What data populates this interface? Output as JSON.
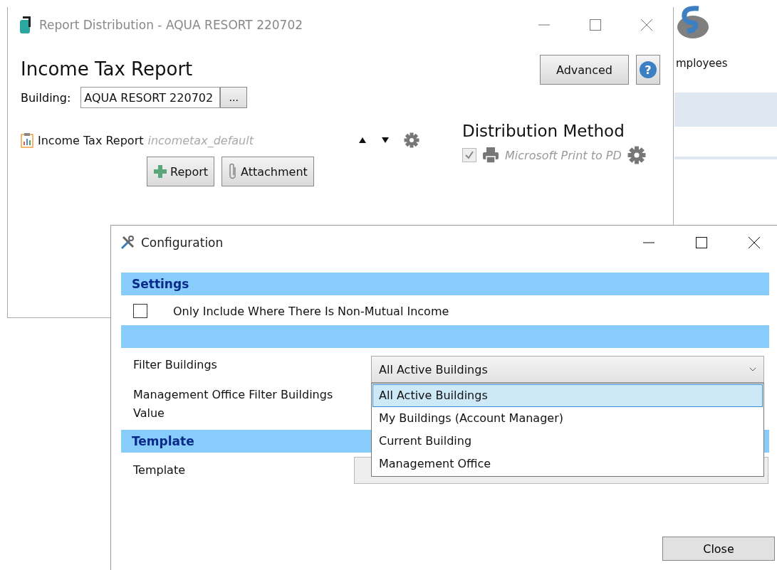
{
  "background_app": {
    "nav_label": "mployees"
  },
  "main_window": {
    "title": "Report Distribution - AQUA RESORT 220702",
    "heading": "Income Tax Report",
    "advanced_button": "Advanced",
    "help_button": "?",
    "building": {
      "label": "Building:",
      "value": "AQUA RESORT 220702",
      "browse_button": "..."
    },
    "report_item": {
      "name": "Income Tax Report",
      "template": "incometax_default"
    },
    "buttons": [
      {
        "kind": "add",
        "label": "Report"
      },
      {
        "kind": "attach",
        "label": "Attachment"
      }
    ],
    "distribution": {
      "title": "Distribution Method",
      "methods": [
        {
          "name": "Microsoft Print to PD",
          "checked": true,
          "disabled": true
        }
      ]
    }
  },
  "config_dialog": {
    "title": "Configuration",
    "close_button": "Close",
    "sections": [
      {
        "header": "Settings",
        "rows": [
          {
            "kind": "checkbox",
            "label": "Only Include Where There Is Non-Mutual Income",
            "checked": false
          }
        ]
      },
      {
        "rows": [
          {
            "kind": "select",
            "label": "Filter Buildings",
            "value": "All Active Buildings",
            "expanded": true,
            "options": [
              {
                "label": "All Active Buildings",
                "selected": true
              },
              {
                "label": "My Buildings (Account Manager)",
                "selected": false
              },
              {
                "label": "Current Building",
                "selected": false
              },
              {
                "label": "Management Office",
                "selected": false
              }
            ]
          },
          {
            "kind": "text",
            "label": "Management Office Filter Buildings Value"
          }
        ]
      },
      {
        "header": "Template",
        "rows": [
          {
            "kind": "template",
            "label": "Template"
          }
        ]
      }
    ]
  }
}
